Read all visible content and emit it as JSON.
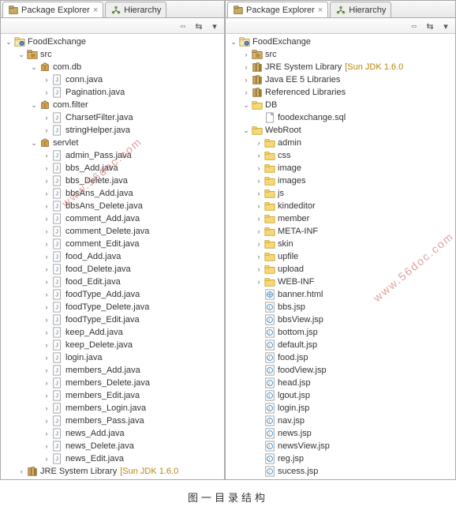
{
  "tabs": {
    "package_explorer": "Package Explorer",
    "hierarchy": "Hierarchy"
  },
  "watermark": "www.56doc.com",
  "caption": "图一目录结构",
  "toolbar": {
    "collapse": "⇔",
    "link": "⇆",
    "menu": "▾"
  },
  "left_tree": [
    {
      "d": 0,
      "t": "v",
      "i": "project",
      "l": "FoodExchange"
    },
    {
      "d": 1,
      "t": "v",
      "i": "src",
      "l": "src"
    },
    {
      "d": 2,
      "t": "v",
      "i": "package",
      "l": "com.db"
    },
    {
      "d": 3,
      "t": ">",
      "i": "java",
      "l": "conn.java"
    },
    {
      "d": 3,
      "t": ">",
      "i": "java",
      "l": "Pagination.java"
    },
    {
      "d": 2,
      "t": "v",
      "i": "package",
      "l": "com.filter"
    },
    {
      "d": 3,
      "t": ">",
      "i": "java",
      "l": "CharsetFilter.java"
    },
    {
      "d": 3,
      "t": ">",
      "i": "java",
      "l": "stringHelper.java"
    },
    {
      "d": 2,
      "t": "v",
      "i": "package",
      "l": "servlet"
    },
    {
      "d": 3,
      "t": ">",
      "i": "java",
      "l": "admin_Pass.java"
    },
    {
      "d": 3,
      "t": ">",
      "i": "java",
      "l": "bbs_Add.java"
    },
    {
      "d": 3,
      "t": ">",
      "i": "java",
      "l": "bbs_Delete.java"
    },
    {
      "d": 3,
      "t": ">",
      "i": "java",
      "l": "bbsAns_Add.java"
    },
    {
      "d": 3,
      "t": ">",
      "i": "java",
      "l": "bbsAns_Delete.java"
    },
    {
      "d": 3,
      "t": ">",
      "i": "java",
      "l": "comment_Add.java"
    },
    {
      "d": 3,
      "t": ">",
      "i": "java",
      "l": "comment_Delete.java"
    },
    {
      "d": 3,
      "t": ">",
      "i": "java",
      "l": "comment_Edit.java"
    },
    {
      "d": 3,
      "t": ">",
      "i": "java",
      "l": "food_Add.java"
    },
    {
      "d": 3,
      "t": ">",
      "i": "java",
      "l": "food_Delete.java"
    },
    {
      "d": 3,
      "t": ">",
      "i": "java",
      "l": "food_Edit.java"
    },
    {
      "d": 3,
      "t": ">",
      "i": "java",
      "l": "foodType_Add.java"
    },
    {
      "d": 3,
      "t": ">",
      "i": "java",
      "l": "foodType_Delete.java"
    },
    {
      "d": 3,
      "t": ">",
      "i": "java",
      "l": "foodType_Edit.java"
    },
    {
      "d": 3,
      "t": ">",
      "i": "java",
      "l": "keep_Add.java"
    },
    {
      "d": 3,
      "t": ">",
      "i": "java",
      "l": "keep_Delete.java"
    },
    {
      "d": 3,
      "t": ">",
      "i": "java",
      "l": "login.java"
    },
    {
      "d": 3,
      "t": ">",
      "i": "java",
      "l": "members_Add.java"
    },
    {
      "d": 3,
      "t": ">",
      "i": "java",
      "l": "members_Delete.java"
    },
    {
      "d": 3,
      "t": ">",
      "i": "java",
      "l": "members_Edit.java"
    },
    {
      "d": 3,
      "t": ">",
      "i": "java",
      "l": "members_Login.java"
    },
    {
      "d": 3,
      "t": ">",
      "i": "java",
      "l": "members_Pass.java"
    },
    {
      "d": 3,
      "t": ">",
      "i": "java",
      "l": "news_Add.java"
    },
    {
      "d": 3,
      "t": ">",
      "i": "java",
      "l": "news_Delete.java"
    },
    {
      "d": 3,
      "t": ">",
      "i": "java",
      "l": "news_Edit.java"
    },
    {
      "d": 1,
      "t": ">",
      "i": "library",
      "l": "JRE System Library",
      "dec": "[Sun JDK 1.6.0"
    }
  ],
  "right_tree": [
    {
      "d": 0,
      "t": "v",
      "i": "project",
      "l": "FoodExchange"
    },
    {
      "d": 1,
      "t": ">",
      "i": "src",
      "l": "src"
    },
    {
      "d": 1,
      "t": ">",
      "i": "library",
      "l": "JRE System Library",
      "dec": "[Sun JDK 1.6.0"
    },
    {
      "d": 1,
      "t": ">",
      "i": "library",
      "l": "Java EE 5 Libraries"
    },
    {
      "d": 1,
      "t": ">",
      "i": "library",
      "l": "Referenced Libraries"
    },
    {
      "d": 1,
      "t": "v",
      "i": "folder",
      "l": "DB"
    },
    {
      "d": 2,
      "t": "",
      "i": "file",
      "l": "foodexchange.sql"
    },
    {
      "d": 1,
      "t": "v",
      "i": "folder",
      "l": "WebRoot"
    },
    {
      "d": 2,
      "t": ">",
      "i": "folder",
      "l": "admin"
    },
    {
      "d": 2,
      "t": ">",
      "i": "folder",
      "l": "css"
    },
    {
      "d": 2,
      "t": ">",
      "i": "folder",
      "l": "image"
    },
    {
      "d": 2,
      "t": ">",
      "i": "folder",
      "l": "images"
    },
    {
      "d": 2,
      "t": ">",
      "i": "folder",
      "l": "js"
    },
    {
      "d": 2,
      "t": ">",
      "i": "folder",
      "l": "kindeditor"
    },
    {
      "d": 2,
      "t": ">",
      "i": "folder",
      "l": "member"
    },
    {
      "d": 2,
      "t": ">",
      "i": "folder",
      "l": "META-INF"
    },
    {
      "d": 2,
      "t": ">",
      "i": "folder",
      "l": "skin"
    },
    {
      "d": 2,
      "t": ">",
      "i": "folder",
      "l": "upfile"
    },
    {
      "d": 2,
      "t": ">",
      "i": "folder",
      "l": "upload"
    },
    {
      "d": 2,
      "t": ">",
      "i": "folder",
      "l": "WEB-INF"
    },
    {
      "d": 2,
      "t": "",
      "i": "html",
      "l": "banner.html"
    },
    {
      "d": 2,
      "t": "",
      "i": "jsp",
      "l": "bbs.jsp"
    },
    {
      "d": 2,
      "t": "",
      "i": "jsp",
      "l": "bbsView.jsp"
    },
    {
      "d": 2,
      "t": "",
      "i": "jsp",
      "l": "bottom.jsp"
    },
    {
      "d": 2,
      "t": "",
      "i": "jsp",
      "l": "default.jsp"
    },
    {
      "d": 2,
      "t": "",
      "i": "jsp",
      "l": "food.jsp"
    },
    {
      "d": 2,
      "t": "",
      "i": "jsp",
      "l": "foodView.jsp"
    },
    {
      "d": 2,
      "t": "",
      "i": "jsp",
      "l": "head.jsp"
    },
    {
      "d": 2,
      "t": "",
      "i": "jsp",
      "l": "lgout.jsp"
    },
    {
      "d": 2,
      "t": "",
      "i": "jsp",
      "l": "login.jsp"
    },
    {
      "d": 2,
      "t": "",
      "i": "jsp",
      "l": "nav.jsp"
    },
    {
      "d": 2,
      "t": "",
      "i": "jsp",
      "l": "news.jsp"
    },
    {
      "d": 2,
      "t": "",
      "i": "jsp",
      "l": "newsView.jsp"
    },
    {
      "d": 2,
      "t": "",
      "i": "jsp",
      "l": "reg.jsp"
    },
    {
      "d": 2,
      "t": "",
      "i": "jsp",
      "l": "sucess.jsp"
    }
  ],
  "icons": {
    "project": "project-icon",
    "src": "source-folder-icon",
    "package": "package-icon",
    "java": "java-file-icon",
    "library": "library-icon",
    "folder": "folder-icon",
    "file": "file-icon",
    "html": "html-file-icon",
    "jsp": "jsp-file-icon"
  }
}
